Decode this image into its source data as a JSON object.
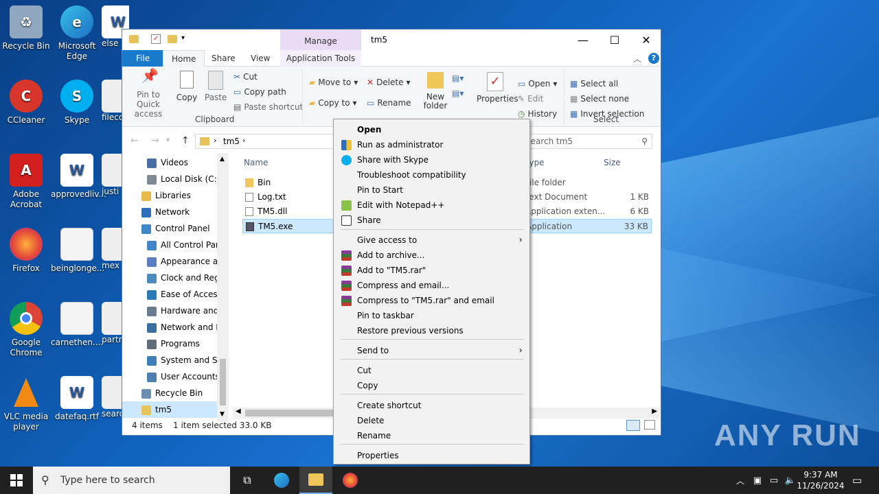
{
  "desktop": {
    "icons": [
      {
        "label": "Recycle Bin",
        "name": "recycle-bin-desktop-icon"
      },
      {
        "label": "Microsoft Edge",
        "name": "edge-desktop-icon"
      },
      {
        "label": "else",
        "name": "word-doc-desktop-icon"
      },
      {
        "label": "CCleaner",
        "name": "ccleaner-desktop-icon"
      },
      {
        "label": "Skype",
        "name": "skype-desktop-icon"
      },
      {
        "label": "fileco",
        "name": "file-desktop-icon"
      },
      {
        "label": "Adobe Acrobat",
        "name": "acrobat-desktop-icon"
      },
      {
        "label": "approvedliv...",
        "name": "word-doc-desktop-icon-2"
      },
      {
        "label": "justi",
        "name": "file-desktop-icon-2"
      },
      {
        "label": "Firefox",
        "name": "firefox-desktop-icon"
      },
      {
        "label": "beinglonge...",
        "name": "image-desktop-icon"
      },
      {
        "label": "mex",
        "name": "file-desktop-icon-3"
      },
      {
        "label": "Google Chrome",
        "name": "chrome-desktop-icon"
      },
      {
        "label": "carnethen....",
        "name": "image-desktop-icon-2"
      },
      {
        "label": "partn",
        "name": "file-desktop-icon-4"
      },
      {
        "label": "VLC media player",
        "name": "vlc-desktop-icon"
      },
      {
        "label": "datefaq.rtf",
        "name": "word-doc-desktop-icon-3"
      },
      {
        "label": "searc",
        "name": "file-desktop-icon-5"
      }
    ],
    "watermark": "ANY RUN"
  },
  "window": {
    "title": "tm5",
    "manage_label": "Manage",
    "tabs": [
      "File",
      "Home",
      "Share",
      "View",
      "Application Tools"
    ],
    "clipboard": {
      "pin": "Pin to Quick access",
      "copy": "Copy",
      "paste": "Paste",
      "cut": "Cut",
      "copy_path": "Copy path",
      "paste_shortcut": "Paste shortcut",
      "group": "Clipboard"
    },
    "organize": {
      "move_to": "Move to",
      "copy_to": "Copy to",
      "delete": "Delete",
      "rename": "Rename"
    },
    "new": {
      "new_folder": "New folder"
    },
    "open": {
      "properties": "Properties",
      "open": "Open",
      "edit": "Edit",
      "history": "History"
    },
    "select": {
      "select_all": "Select all",
      "select_none": "Select none",
      "invert": "Invert selection",
      "group": "Select"
    },
    "address": {
      "path": "tm5",
      "search_placeholder": "Search tm5"
    },
    "nav": [
      {
        "label": "Videos",
        "color": "#4a6fa5"
      },
      {
        "label": "Local Disk (C:)",
        "color": "#7d8a96"
      },
      {
        "label": "Libraries",
        "color": "#e8b84a"
      },
      {
        "label": "Network",
        "color": "#2d6fb8"
      },
      {
        "label": "Control Panel",
        "color": "#3f86c8"
      },
      {
        "label": "All Control Par",
        "color": "#3f86c8"
      },
      {
        "label": "Appearance an",
        "color": "#5a7fc0"
      },
      {
        "label": "Clock and Regi",
        "color": "#4d8bbd"
      },
      {
        "label": "Ease of Access",
        "color": "#2a7ab8"
      },
      {
        "label": "Hardware and",
        "color": "#6a7c8e"
      },
      {
        "label": "Network and In",
        "color": "#3a6fa0"
      },
      {
        "label": "Programs",
        "color": "#5f6c7a"
      },
      {
        "label": "System and Sec",
        "color": "#3f7fb8"
      },
      {
        "label": "User Accounts",
        "color": "#4d7fae"
      },
      {
        "label": "Recycle Bin",
        "color": "#6b8fb0"
      },
      {
        "label": "tm5",
        "color": "#e8c25a"
      }
    ],
    "columns": {
      "name": "Name",
      "type": "Type",
      "size": "Size"
    },
    "files": [
      {
        "name": "Bin",
        "type": "File folder",
        "size": ""
      },
      {
        "name": "Log.txt",
        "type": "Text Document",
        "size": "1 KB"
      },
      {
        "name": "TM5.dll",
        "type": "Application exten...",
        "size": "6 KB"
      },
      {
        "name": "TM5.exe",
        "type": "Application",
        "size": "33 KB"
      }
    ],
    "status": {
      "count": "4 items",
      "selected": "1 item selected  33.0 KB"
    }
  },
  "context_menu": {
    "items": [
      {
        "label": "Open",
        "bold": true
      },
      {
        "label": "Run as administrator",
        "icon": "shield-icon"
      },
      {
        "label": "Share with Skype",
        "icon": "skype-icon"
      },
      {
        "label": "Troubleshoot compatibility"
      },
      {
        "label": "Pin to Start"
      },
      {
        "label": "Edit with Notepad++",
        "icon": "notepad-plus-plus-icon"
      },
      {
        "label": "Share",
        "icon": "share-icon"
      },
      {
        "label": "Give access to",
        "submenu": true
      },
      {
        "label": "Add to archive...",
        "icon": "winrar-icon"
      },
      {
        "label": "Add to \"TM5.rar\"",
        "icon": "winrar-icon"
      },
      {
        "label": "Compress and email...",
        "icon": "winrar-icon"
      },
      {
        "label": "Compress to \"TM5.rar\" and email",
        "icon": "winrar-icon"
      },
      {
        "label": "Pin to taskbar"
      },
      {
        "label": "Restore previous versions"
      },
      {
        "label": "Send to",
        "submenu": true
      },
      {
        "label": "Cut"
      },
      {
        "label": "Copy"
      },
      {
        "label": "Create shortcut"
      },
      {
        "label": "Delete"
      },
      {
        "label": "Rename"
      },
      {
        "label": "Properties"
      }
    ]
  },
  "taskbar": {
    "search_placeholder": "Type here to search",
    "time": "9:37 AM",
    "date": "11/26/2024"
  }
}
